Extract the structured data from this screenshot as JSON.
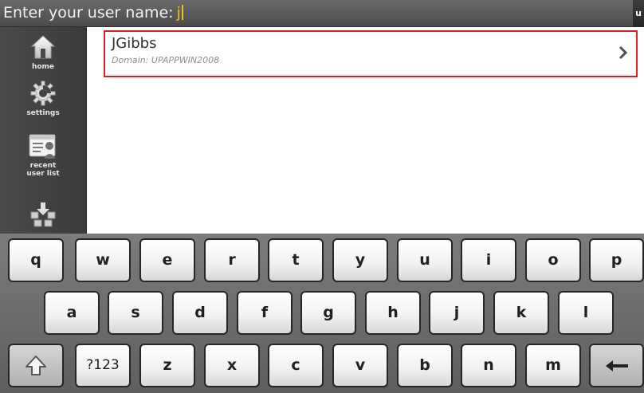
{
  "prompt": {
    "label": "Enter your user name:",
    "typed": "j",
    "corner_tab": "u"
  },
  "sidebar": {
    "items": [
      {
        "label": "home",
        "icon": "home-icon"
      },
      {
        "label": "settings",
        "icon": "gear-icon"
      },
      {
        "label": "recent user list",
        "icon": "contact-card-icon"
      },
      {
        "label": "",
        "icon": "network-download-icon"
      }
    ]
  },
  "user_list": [
    {
      "name": "JGibbs",
      "domain": "Domain: UPAPPWIN2008",
      "icon": "chevron-right-icon"
    }
  ],
  "keyboard": {
    "row1": [
      "q",
      "w",
      "e",
      "r",
      "t",
      "y",
      "u",
      "i",
      "o",
      "p"
    ],
    "row2": [
      "a",
      "s",
      "d",
      "f",
      "g",
      "h",
      "j",
      "k",
      "l"
    ],
    "row3": [
      "z",
      "x",
      "c",
      "v",
      "b",
      "n",
      "m"
    ],
    "shift_icon": "shift-arrow-icon",
    "symbols_label": "?123",
    "backspace_icon": "backspace-arrow-icon"
  },
  "colors": {
    "highlight_border": "#d82020",
    "typed_text": "#f0c020",
    "sidebar_bg": "#434343",
    "keyboard_bg": "#6c6c6c"
  }
}
